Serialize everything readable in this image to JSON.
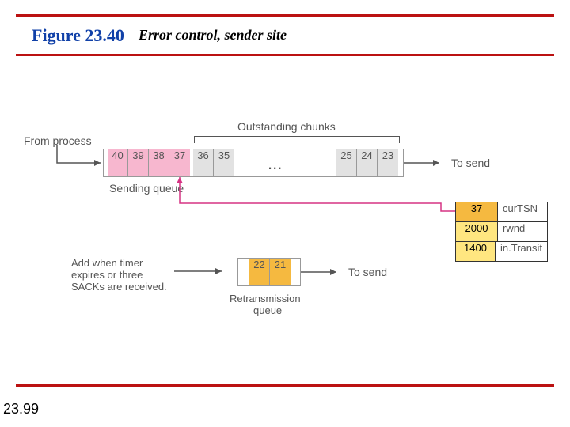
{
  "header": {
    "fig_no": "Figure 23.40",
    "fig_title": "Error control, sender site"
  },
  "page_number": "23.99",
  "labels": {
    "from_process": "From process",
    "outstanding": "Outstanding chunks",
    "sending_queue": "Sending queue",
    "to_send_1": "To send",
    "to_send_2": "To send",
    "add_when_1": "Add when timer",
    "add_when_2": "expires or three",
    "add_when_3": "SACKs are received.",
    "retrans_queue_1": "Retransmission",
    "retrans_queue_2": "queue",
    "ellipsis": "..."
  },
  "sending_new": [
    "40",
    "39",
    "38",
    "37"
  ],
  "sending_out": [
    "36",
    "35"
  ],
  "sending_far": [
    "25",
    "24",
    "23"
  ],
  "retrans": [
    "22",
    "21"
  ],
  "status": {
    "curTSN": {
      "val": "37",
      "lbl": "curTSN"
    },
    "rwnd": {
      "val": "2000",
      "lbl": "rwnd"
    },
    "inTransit": {
      "val": "1400",
      "lbl": "in.Transit"
    }
  }
}
